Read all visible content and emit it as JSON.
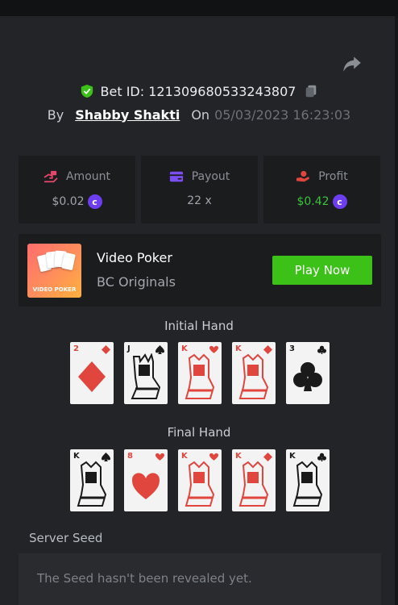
{
  "bet": {
    "id_label": "Bet ID: 121309680533243807",
    "by_label": "By",
    "user": "Shabby Shakti",
    "on_label": "On",
    "datetime": "05/03/2023 16:23:03"
  },
  "stats": [
    {
      "label": "Amount",
      "value": "$0.02",
      "icon": "amount-icon",
      "coin": true,
      "color": "#a0a4aa"
    },
    {
      "label": "Payout",
      "value": "22 x",
      "icon": "card-icon",
      "coin": false,
      "color": "#a0a4aa"
    },
    {
      "label": "Profit",
      "value": "$0.42",
      "icon": "profit-icon",
      "coin": true,
      "color": "#3ac33a"
    }
  ],
  "game": {
    "title": "Video Poker",
    "subtitle": "BC Originals",
    "thumb_label": "VIDEO POKER",
    "play_label": "Play Now"
  },
  "initial_hand": {
    "title": "Initial Hand",
    "cards": [
      {
        "rank": "2",
        "suit": "diamond"
      },
      {
        "rank": "J",
        "suit": "spade"
      },
      {
        "rank": "K",
        "suit": "heart"
      },
      {
        "rank": "K",
        "suit": "diamond"
      },
      {
        "rank": "3",
        "suit": "club"
      }
    ]
  },
  "final_hand": {
    "title": "Final Hand",
    "cards": [
      {
        "rank": "K",
        "suit": "spade"
      },
      {
        "rank": "8",
        "suit": "heart"
      },
      {
        "rank": "K",
        "suit": "heart"
      },
      {
        "rank": "K",
        "suit": "diamond"
      },
      {
        "rank": "K",
        "suit": "club"
      }
    ]
  },
  "server_seed": {
    "title": "Server Seed",
    "text": "The Seed hasn't been revealed yet."
  },
  "colors": {
    "background": "#232427",
    "panel": "#1b1c1e",
    "accent_green": "#3bc117",
    "coin_purple": "#6d3df0",
    "card_red": "#e0463e"
  }
}
